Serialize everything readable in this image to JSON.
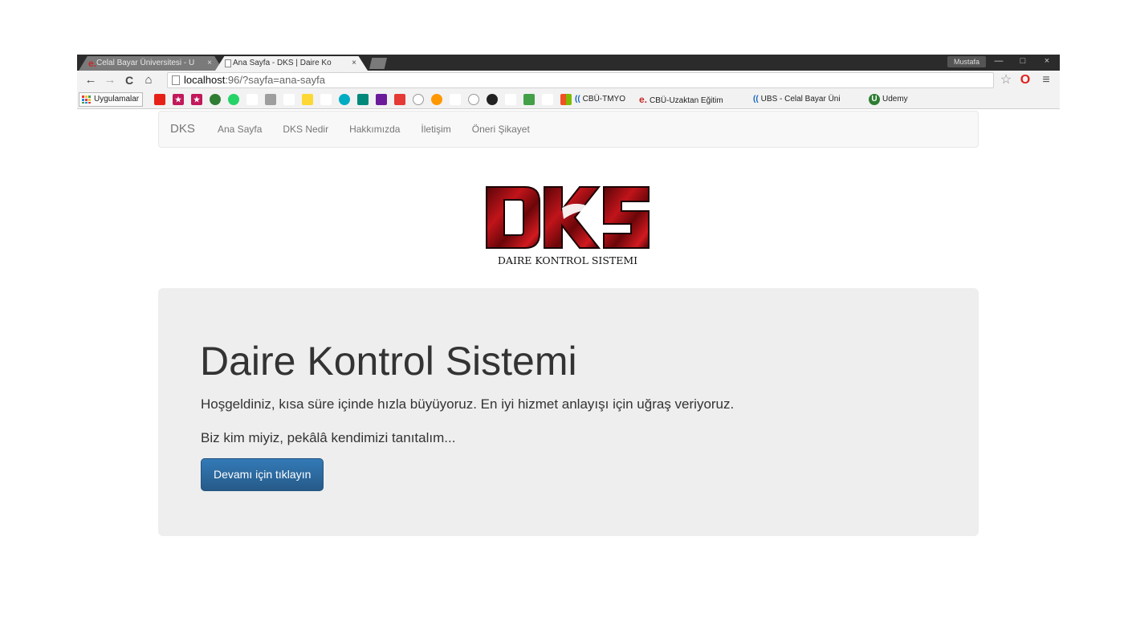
{
  "browser": {
    "tabs": [
      {
        "label": "Celal Bayar Üniversitesi - U",
        "favicon": "e."
      },
      {
        "label": "Ana Sayfa - DKS | Daire Ko",
        "favicon": ""
      }
    ],
    "profile_name": "Mustafa",
    "address": {
      "host": "localhost",
      "rest": ":96/?sayfa=ana-sayfa"
    },
    "bookmarks": {
      "apps_label": "Uygulamalar",
      "items": [
        {
          "label": "CBÜ-TMYO",
          "favicon": "(("
        },
        {
          "label": "CBÜ-Uzaktan Eğitim",
          "favicon": "e."
        },
        {
          "label": "UBS - Celal Bayar Üni",
          "favicon": "(("
        },
        {
          "label": "Udemy",
          "favicon": "U"
        }
      ]
    },
    "icons": {
      "back": "←",
      "forward": "→",
      "reload": "C",
      "home": "⌂",
      "star": "☆",
      "opera": "O",
      "menu": "≡",
      "close": "×",
      "minimize": "—",
      "maximize": "□"
    }
  },
  "navbar": {
    "brand": "DKS",
    "items": [
      "Ana Sayfa",
      "DKS Nedir",
      "Hakkımızda",
      "İletişim",
      "Öneri Şikayet"
    ]
  },
  "logo": {
    "letters": "DKS",
    "caption": "DAIRE KONTROL SISTEMI"
  },
  "jumbotron": {
    "title": "Daire Kontrol Sistemi",
    "lead": "Hoşgeldiniz, kısa süre içinde hızla büyüyoruz. En iyi hizmet anlayışı için uğraş veriyoruz.",
    "sub": "Biz kim miyiz, pekâlâ kendimizi tanıtalım...",
    "button": "Devamı için tıklayın"
  },
  "colors": {
    "primary_button": "#337ab7",
    "jumbotron_bg": "#eeeeee",
    "navbar_bg": "#f8f8f8",
    "logo_red": "#a10d12"
  }
}
